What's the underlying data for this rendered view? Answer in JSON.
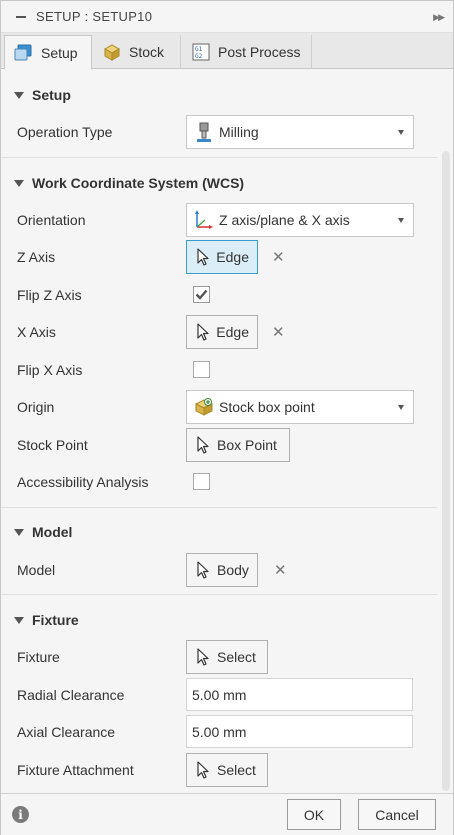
{
  "window": {
    "title": "SETUP : SETUP10"
  },
  "tabs": [
    {
      "label": "Setup",
      "icon": "setup-icon",
      "active": true
    },
    {
      "label": "Stock",
      "icon": "stock-icon"
    },
    {
      "label": "Post Process",
      "icon": "post-process-icon"
    }
  ],
  "sections": {
    "setup": {
      "title": "Setup",
      "operation_type_label": "Operation Type",
      "operation_type_value": "Milling"
    },
    "wcs": {
      "title": "Work Coordinate System (WCS)",
      "orientation_label": "Orientation",
      "orientation_value": "Z axis/plane & X axis",
      "z_axis_label": "Z Axis",
      "z_axis_button": "Edge",
      "flip_z_label": "Flip Z Axis",
      "flip_z_checked": true,
      "x_axis_label": "X Axis",
      "x_axis_button": "Edge",
      "flip_x_label": "Flip X Axis",
      "flip_x_checked": false,
      "origin_label": "Origin",
      "origin_value": "Stock box point",
      "stock_point_label": "Stock Point",
      "stock_point_button": "Box Point",
      "accessibility_label": "Accessibility Analysis",
      "accessibility_checked": false
    },
    "model": {
      "title": "Model",
      "model_label": "Model",
      "model_button": "Body"
    },
    "fixture": {
      "title": "Fixture",
      "fixture_label": "Fixture",
      "fixture_button": "Select",
      "radial_label": "Radial Clearance",
      "radial_value": "5.00 mm",
      "axial_label": "Axial Clearance",
      "axial_value": "5.00 mm",
      "attachment_label": "Fixture Attachment",
      "attachment_button": "Select"
    }
  },
  "clear_glyph": "✕",
  "footer": {
    "ok_label": "OK",
    "cancel_label": "Cancel",
    "info_glyph": "i"
  },
  "colors": {
    "active_select_bg": "#dbeef7",
    "active_select_border": "#3b9bc9"
  }
}
